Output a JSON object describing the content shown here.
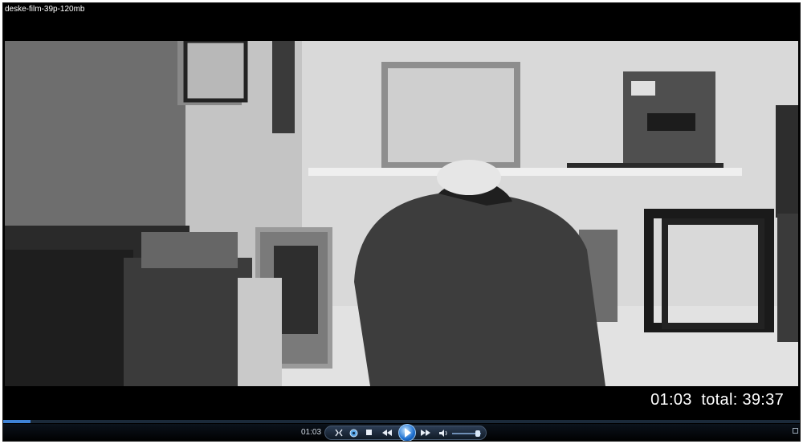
{
  "window": {
    "title": "deske-film-39p-120mb"
  },
  "overlay": {
    "current_time": "01:03",
    "total_label": "total:",
    "total_time": "39:37"
  },
  "player": {
    "progress_fraction": 0.034,
    "elapsed_time": "01:03",
    "volume_fraction": 0.9,
    "icons": {
      "switch_mode": "switch-mode-icon",
      "settings": "settings-icon",
      "stop": "stop-icon",
      "previous": "previous-icon",
      "play": "play-icon",
      "next": "next-icon",
      "volume": "speaker-icon",
      "fullscreen": "fullscreen-icon"
    },
    "accent_color": "#3f83d6"
  }
}
